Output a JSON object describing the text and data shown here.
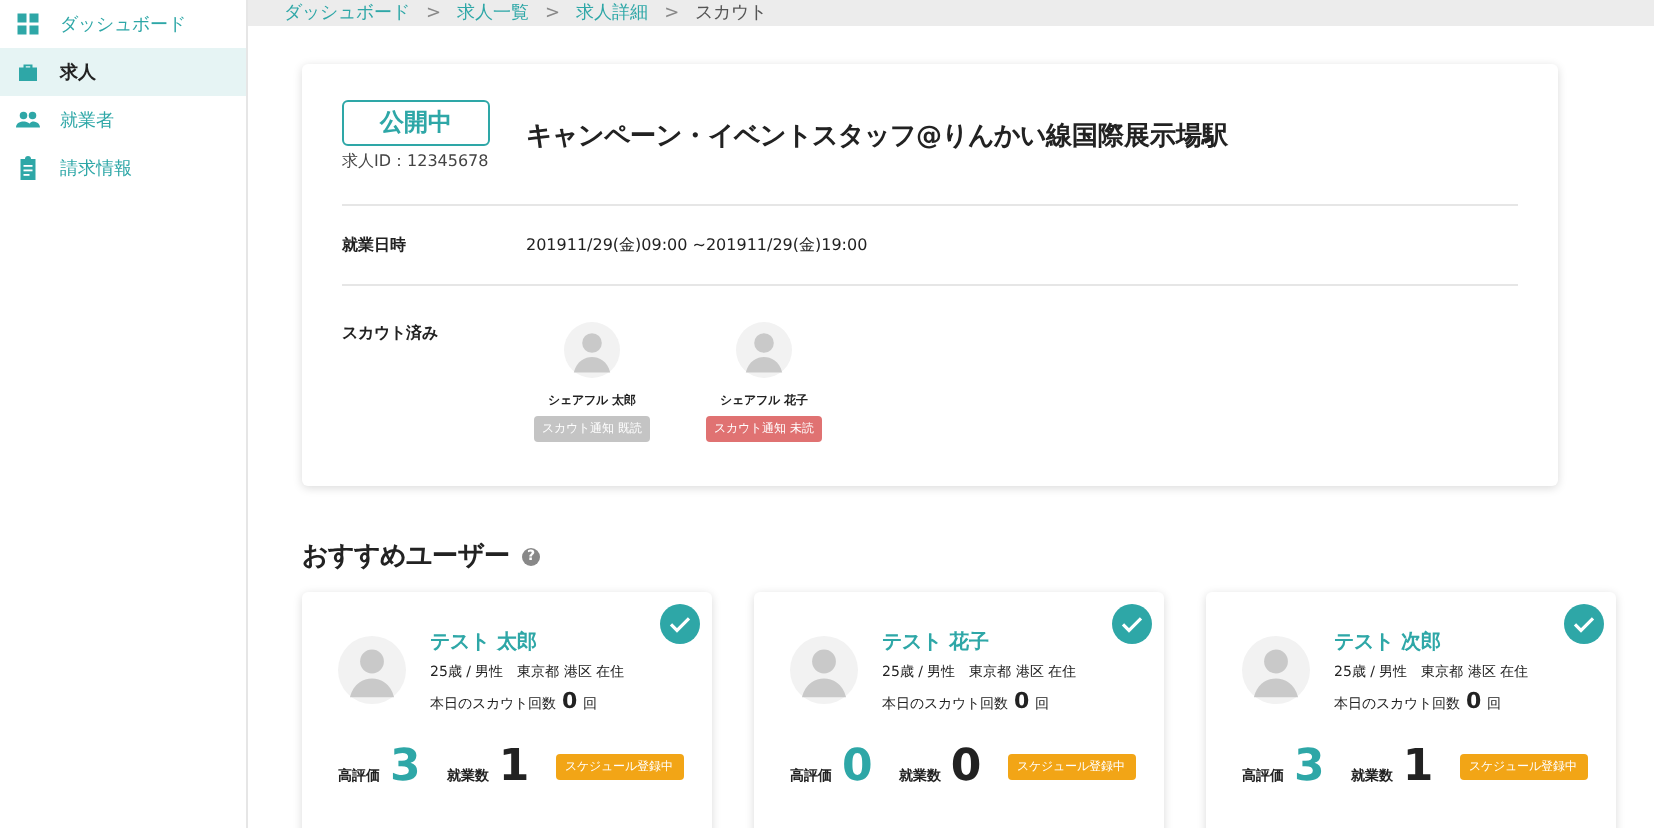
{
  "sidebar": {
    "items": [
      {
        "label": "ダッシュボード",
        "kind": "dashboard",
        "selected": false
      },
      {
        "label": "求人",
        "kind": "jobs",
        "selected": true
      },
      {
        "label": "就業者",
        "kind": "workers",
        "selected": false
      },
      {
        "label": "請求情報",
        "kind": "billing",
        "selected": false
      }
    ]
  },
  "breadcrumb": [
    {
      "label": "ダッシュボード",
      "link": true
    },
    {
      "label": "求人一覧",
      "link": true
    },
    {
      "label": "求人詳細",
      "link": true
    },
    {
      "label": "スカウト",
      "link": false
    }
  ],
  "breadcrumb_separator": ">",
  "job": {
    "status": "公開中",
    "job_id": "求人ID：12345678",
    "title": "キャンペーン・イベントスタッフ@りんかい線国際展示場駅",
    "schedule_label": "就業日時",
    "schedule": "201911/29(金)09:00 ~201911/29(金)19:00",
    "scouted_label": "スカウト済み",
    "scouted": [
      {
        "name": "シェアフル 太郎",
        "status": "スカウト通知 既読",
        "read": true
      },
      {
        "name": "シェアフル 花子",
        "status": "スカウト通知 未読",
        "read": false
      }
    ]
  },
  "recommended": {
    "title": "おすすめユーザー",
    "help_icon": "?",
    "users": [
      {
        "name": "テスト 太郎",
        "profile": "25歳 / 男性　東京都 港区 在住",
        "scout_label": "本日のスカウト回数",
        "scout_count": "0",
        "scout_unit": "回",
        "rating_label": "高評価",
        "rating": "3",
        "jobs_label": "就業数",
        "jobs": "1",
        "badge": "スケジュール登録中",
        "checked": true
      },
      {
        "name": "テスト 花子",
        "profile": "25歳 / 男性　東京都 港区 在住",
        "scout_label": "本日のスカウト回数",
        "scout_count": "0",
        "scout_unit": "回",
        "rating_label": "高評価",
        "rating": "0",
        "jobs_label": "就業数",
        "jobs": "0",
        "badge": "スケジュール登録中",
        "checked": true
      },
      {
        "name": "テスト 次郎",
        "profile": "25歳 / 男性　東京都 港区 在住",
        "scout_label": "本日のスカウト回数",
        "scout_count": "0",
        "scout_unit": "回",
        "rating_label": "高評価",
        "rating": "3",
        "jobs_label": "就業数",
        "jobs": "1",
        "badge": "スケジュール登録中",
        "checked": true
      }
    ]
  }
}
